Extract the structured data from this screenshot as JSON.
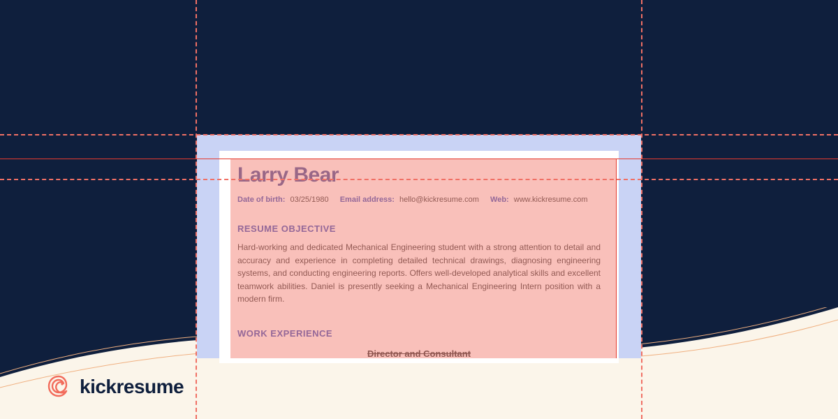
{
  "brand": {
    "name": "kickresume"
  },
  "resume": {
    "name": "Larry Bear",
    "contact": {
      "dob_label": "Date of birth:",
      "dob_value": "03/25/1980",
      "email_label": "Email address:",
      "email_value": "hello@kickresume.com",
      "web_label": "Web:",
      "web_value": "www.kickresume.com"
    },
    "sections": {
      "objective_heading": "RESUME OBJECTIVE",
      "objective_body": "Hard-working and dedicated Mechanical Engineering student with a strong attention to detail and accuracy and experience in completing detailed technical drawings, diagnosing engineering systems, and conducting engineering reports. Offers well-developed analytical skills and excellent teamwork abilities. Daniel is presently seeking a Mechanical Engineering Intern position with a modern firm.",
      "experience_heading": "WORK EXPERIENCE",
      "job_title_fragment": "Director and Consultant"
    }
  }
}
